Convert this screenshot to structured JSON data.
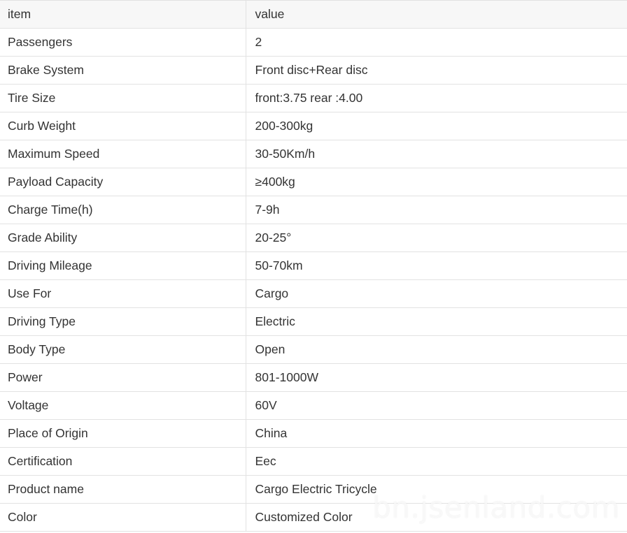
{
  "table": {
    "headers": {
      "item": "item",
      "value": "value"
    },
    "rows": [
      {
        "item": "Passengers",
        "value": "2"
      },
      {
        "item": "Brake System",
        "value": "Front disc+Rear disc"
      },
      {
        "item": "Tire Size",
        "value": "front:3.75 rear :4.00"
      },
      {
        "item": "Curb Weight",
        "value": "200-300kg"
      },
      {
        "item": "Maximum Speed",
        "value": "30-50Km/h"
      },
      {
        "item": "Payload Capacity",
        "value": "≥400kg"
      },
      {
        "item": "Charge Time(h)",
        "value": "7-9h"
      },
      {
        "item": "Grade Ability",
        "value": "20-25°"
      },
      {
        "item": "Driving Mileage",
        "value": "50-70km"
      },
      {
        "item": "Use For",
        "value": "Cargo"
      },
      {
        "item": "Driving Type",
        "value": "Electric"
      },
      {
        "item": "Body Type",
        "value": "Open"
      },
      {
        "item": "Power",
        "value": "801-1000W"
      },
      {
        "item": "Voltage",
        "value": "60V"
      },
      {
        "item": "Place of Origin",
        "value": "China"
      },
      {
        "item": "Certification",
        "value": "Eec"
      },
      {
        "item": "Product name",
        "value": "Cargo Electric Tricycle"
      },
      {
        "item": "Color",
        "value": "Customized Color"
      }
    ]
  },
  "watermark": "bn.jsenland.com"
}
